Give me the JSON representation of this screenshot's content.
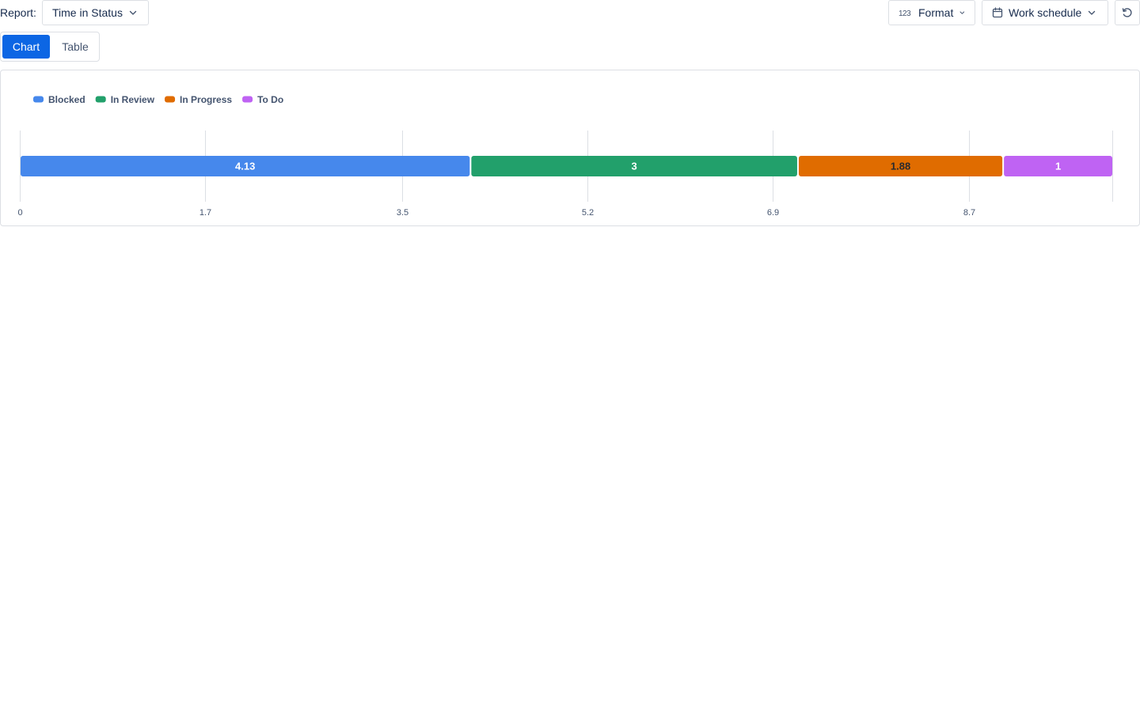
{
  "toolbar": {
    "report_label": "Report:",
    "report_value": "Time in Status",
    "format_label": "Format",
    "format_icon": "123",
    "schedule_label": "Work schedule"
  },
  "view_toggle": {
    "chart_label": "Chart",
    "table_label": "Table",
    "selected": "Chart"
  },
  "chart_data": {
    "type": "bar",
    "orientation": "horizontal-stacked",
    "series": [
      {
        "name": "Blocked",
        "value": 4.13,
        "label": "4.13",
        "color": "#4688ec",
        "label_color": "#ffffff"
      },
      {
        "name": "In Review",
        "value": 3,
        "label": "3",
        "color": "#22a06b",
        "label_color": "#ffffff"
      },
      {
        "name": "In Progress",
        "value": 1.88,
        "label": "1.88",
        "color": "#e06c00",
        "label_color": "#292a2e"
      },
      {
        "name": "To Do",
        "value": 1,
        "label": "1",
        "color": "#bf63f3",
        "label_color": "#ffffff"
      }
    ],
    "x_ticks": [
      "0",
      "1.7",
      "3.5",
      "5.2",
      "6.9",
      "8.7"
    ],
    "xlim": [
      0,
      10.01
    ],
    "grid": true,
    "legend_position": "top-left"
  }
}
